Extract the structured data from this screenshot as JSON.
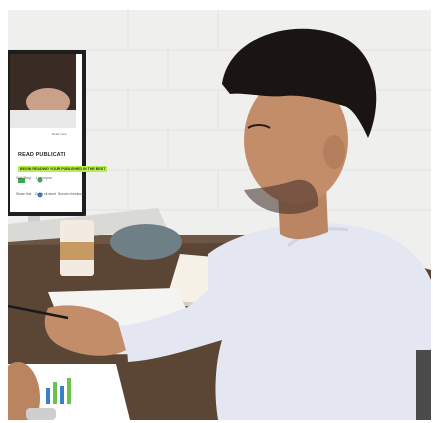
{
  "image": {
    "width": 433,
    "height": 423,
    "colors": {
      "background": "#efefed",
      "brick_wall": "#f4f4f2",
      "desk": "#5b4636",
      "shirt": "#e4e6f2",
      "hair": "#1a1512",
      "skin": "#c48d6a",
      "screen_highlight": "#b9ec4e"
    }
  },
  "monitor": {
    "heading": "READ PUBLICATI",
    "highlight": "BEGIN READING YOUR PUBLISHED IN THE BEST",
    "row1_left": "Visit Shop",
    "row1_mid": "Loren ipsu",
    "row2_left": "Share this",
    "row2_mid": "Dolor sit amet",
    "row2_right": "Secure checkout",
    "small_right": "Read more"
  }
}
